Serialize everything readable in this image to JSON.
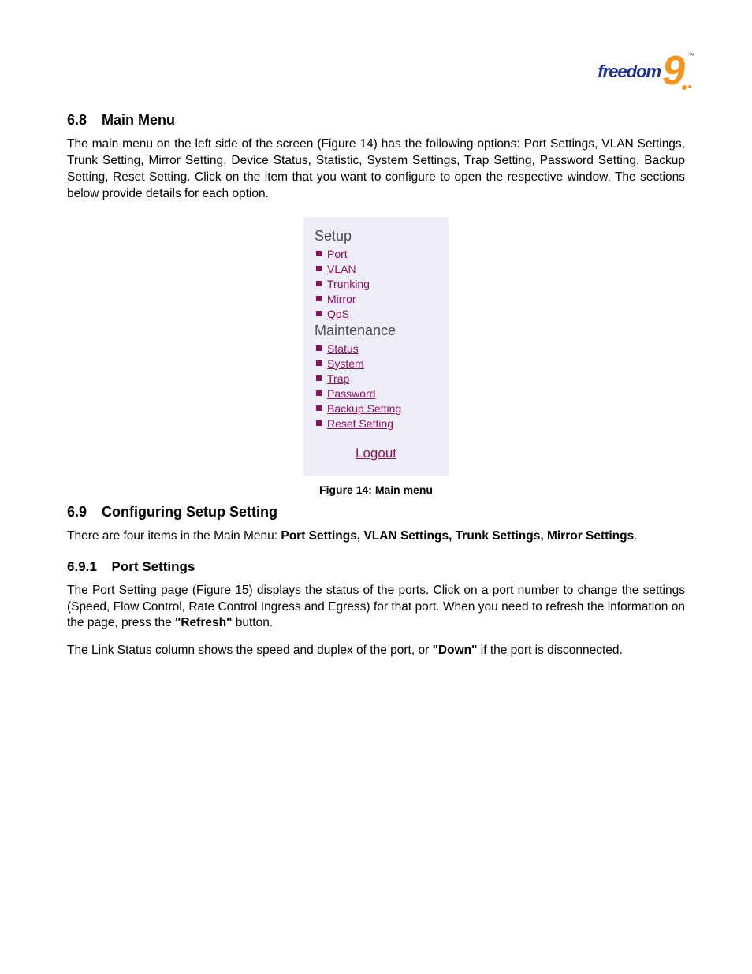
{
  "logo": {
    "text": "freedom",
    "number": "9",
    "tm": "™"
  },
  "section_6_8": {
    "number": "6.8",
    "title": "Main Menu",
    "paragraph": "The main menu on the left side of the screen (Figure 14) has the following options: Port Settings, VLAN Settings, Trunk Setting, Mirror Setting, Device Status, Statistic, System Settings, Trap Setting, Password Setting, Backup Setting, Reset Setting.  Click on the item that you want to configure to open the respective window.  The sections below provide details for each option."
  },
  "menu": {
    "setup_header": "Setup",
    "setup_items": [
      {
        "label": "Port"
      },
      {
        "label": "VLAN"
      },
      {
        "label": "Trunking"
      },
      {
        "label": "Mirror"
      },
      {
        "label": "QoS"
      }
    ],
    "maintenance_header": "Maintenance",
    "maintenance_items": [
      {
        "label": "Status"
      },
      {
        "label": "System"
      },
      {
        "label": "Trap"
      },
      {
        "label": "Password"
      },
      {
        "label": "Backup Setting"
      },
      {
        "label": "Reset Setting"
      }
    ],
    "logout": "Logout"
  },
  "figure_caption": "Figure 14: Main menu",
  "section_6_9": {
    "number": "6.9",
    "title": "Configuring Setup Setting",
    "para_prefix": "There are four items in the Main Menu: ",
    "para_bold": "Port Settings, VLAN Settings, Trunk Settings, Mirror Settings",
    "para_suffix": "."
  },
  "section_6_9_1": {
    "number": "6.9.1",
    "title": "Port Settings",
    "para1_a": "The Port Setting page (Figure 15) displays the status of the ports.  Click on a port number to change the settings (Speed, Flow Control, Rate Control Ingress and Egress) for that port. When you need to refresh the information on the page, press the ",
    "para1_bold": "\"Refresh\"",
    "para1_b": " button.",
    "para2_a": "The Link Status column shows the speed and duplex of the port, or ",
    "para2_bold": "\"Down\"",
    "para2_b": " if the port is disconnected."
  }
}
